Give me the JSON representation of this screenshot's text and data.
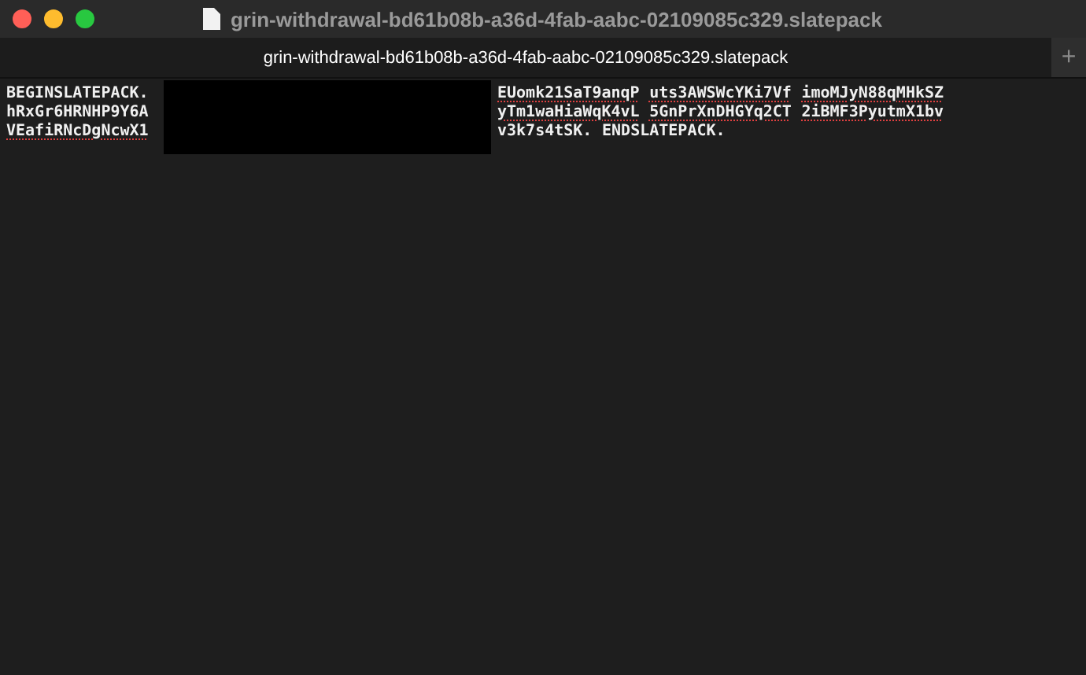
{
  "window": {
    "title": "grin-withdrawal-bd61b08b-a36d-4fab-aabc-02109085c329.slatepack"
  },
  "tabs": [
    {
      "label": "grin-withdrawal-bd61b08b-a36d-4fab-aabc-02109085c329.slatepack",
      "selected": true
    }
  ],
  "new_tab_button": "+",
  "lines": [
    {
      "left": {
        "text": "BEGINSLATEPACK.",
        "misspelled": false
      },
      "right": [
        {
          "text": "EUomk21SaT9anqP",
          "misspelled": true
        },
        {
          "text": "uts3AWSWcYKi7Vf",
          "misspelled": true
        },
        {
          "text": "imoMJyN88qMHkSZ",
          "misspelled": true
        }
      ]
    },
    {
      "left": {
        "text": "hRxGr6HRNHP9Y6A",
        "misspelled": false
      },
      "right": [
        {
          "text": "yTm1waHiaWqK4vL",
          "misspelled": true
        },
        {
          "text": "5GnPrXnDHGYq2CT",
          "misspelled": true
        },
        {
          "text": "2iBMF3PyutmX1bv",
          "misspelled": true
        }
      ]
    },
    {
      "left": {
        "text": "VEafiRNcDgNcwX1",
        "misspelled": true
      },
      "right": [
        {
          "text": "v3k7s4tSK.",
          "misspelled": false
        },
        {
          "text": "ENDSLATEPACK.",
          "misspelled": false
        }
      ]
    }
  ]
}
